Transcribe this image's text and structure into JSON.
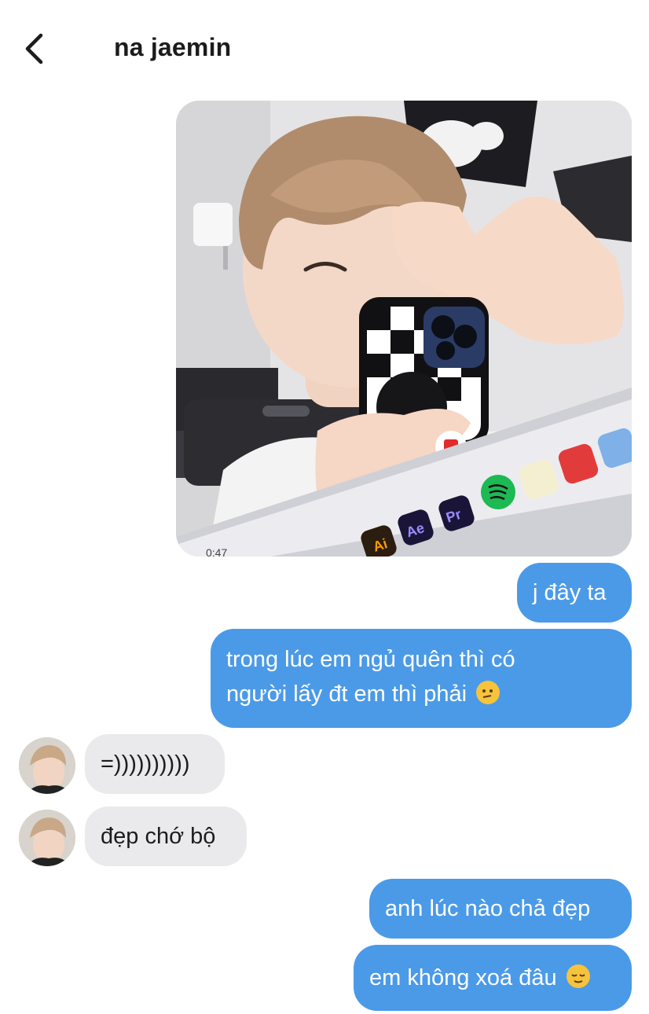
{
  "header": {
    "back_icon": "chevron-left-icon",
    "title": "na jaemin"
  },
  "media": {
    "icon": "photo-message",
    "overlay_text": "0:47",
    "dock_labels": [
      "Ai",
      "Ae",
      "Pr"
    ]
  },
  "messages": [
    {
      "id": "m1",
      "direction": "sent",
      "text": "j đây ta"
    },
    {
      "id": "m2",
      "direction": "sent",
      "lines": [
        "trong lúc em ngủ quên thì có",
        "người lấy đt em thì phải"
      ],
      "emoji": "thinking-face-icon"
    },
    {
      "id": "m3",
      "direction": "received",
      "text": "=))))))))))"
    },
    {
      "id": "m4",
      "direction": "received",
      "text": "đẹp chớ bộ"
    },
    {
      "id": "m5",
      "direction": "sent",
      "text": "anh lúc nào chả đẹp"
    },
    {
      "id": "m6",
      "direction": "sent",
      "text": "em không xoá đâu",
      "emoji": "relieved-face-icon"
    }
  ],
  "colors": {
    "sent_bubble": "#4b9ae8",
    "received_bubble": "#eaeaec",
    "text_dark": "#1c1c1e",
    "emoji_yellow": "#f6c33d"
  }
}
